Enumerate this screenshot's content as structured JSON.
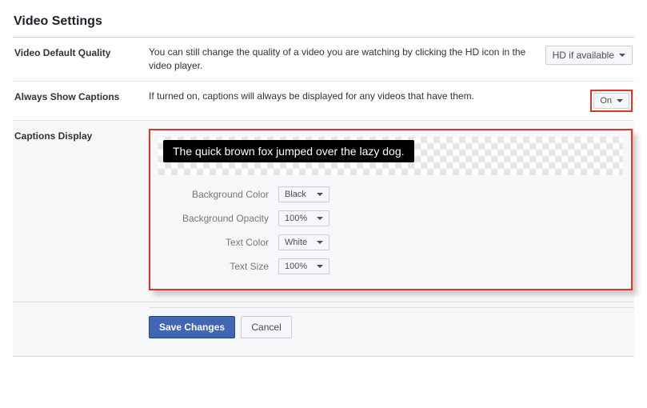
{
  "page_title": "Video Settings",
  "rows": {
    "default_quality": {
      "label": "Video Default Quality",
      "description": "You can still change the quality of a video you are watching by clicking the HD icon in the video player.",
      "value": "HD if available"
    },
    "always_captions": {
      "label": "Always Show Captions",
      "description": "If turned on, captions will always be displayed for any videos that have them.",
      "value": "On"
    },
    "captions_display": {
      "label": "Captions Display",
      "preview_text": "The quick brown fox jumped over the lazy dog.",
      "options": {
        "bg_color_label": "Background Color",
        "bg_color_value": "Black",
        "bg_opacity_label": "Background Opacity",
        "bg_opacity_value": "100%",
        "text_color_label": "Text Color",
        "text_color_value": "White",
        "text_size_label": "Text Size",
        "text_size_value": "100%"
      }
    }
  },
  "buttons": {
    "save": "Save Changes",
    "cancel": "Cancel"
  }
}
